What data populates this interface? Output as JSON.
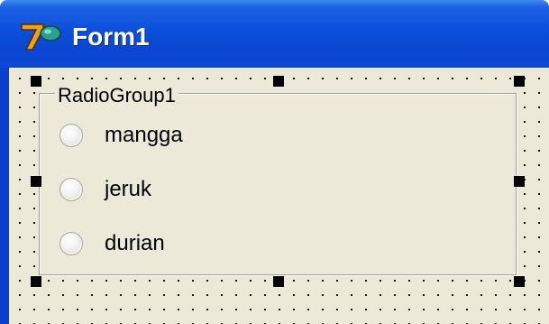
{
  "window": {
    "title": "Form1",
    "icon": "delphi-7-icon"
  },
  "radio_group": {
    "caption": "RadioGroup1",
    "items": [
      {
        "label": "mangga",
        "selected": false
      },
      {
        "label": "jeruk",
        "selected": false
      },
      {
        "label": "durian",
        "selected": false
      }
    ]
  },
  "colors": {
    "titlebar": "#0a46d0",
    "form_background": "#ece9d8",
    "grid_dots": "#000000",
    "selection_handles": "#000000"
  }
}
